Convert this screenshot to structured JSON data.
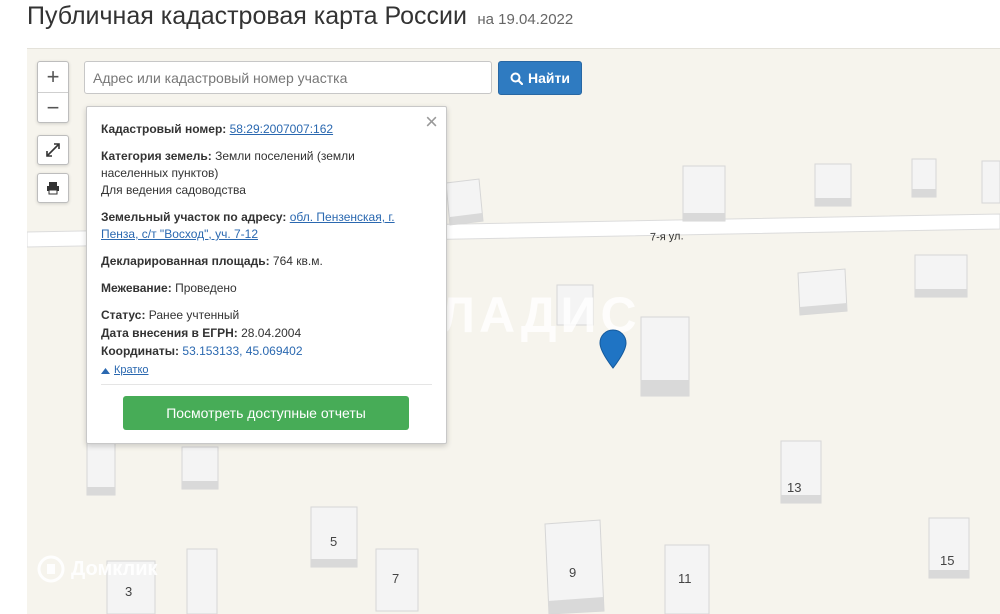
{
  "header": {
    "title": "Публичная кадастровая карта России",
    "date": "на 19.04.2022"
  },
  "search": {
    "placeholder": "Адрес или кадастровый номер участка",
    "value": "",
    "button_label": "Найти"
  },
  "map_controls": {
    "zoom_in": "+",
    "zoom_out": "−"
  },
  "popup": {
    "cadastral_label": "Кадастровый номер:",
    "cadastral_value": "58:29:2007007:162",
    "category_label": "Категория земель:",
    "category_value": "Земли поселений (земли населенных пунктов)",
    "usage_value": "Для ведения садоводства",
    "address_label": "Земельный участок по адресу:",
    "address_value": "обл. Пензенская, г. Пенза, с/т \"Восход\", уч. 7-12",
    "area_label": "Декларированная площадь:",
    "area_value": "764 кв.м.",
    "survey_label": "Межевание:",
    "survey_value": "Проведено",
    "status_label": "Статус:",
    "status_value": "Ранее учтенный",
    "egrn_label": "Дата внесения в ЕГРН:",
    "egrn_value": "28.04.2004",
    "coords_label": "Координаты:",
    "coords_value": "53.153133, 45.069402",
    "collapse_label": "Кратко",
    "reports_button": "Посмотреть доступные отчеты",
    "close_symbol": "×"
  },
  "map": {
    "street_label": "7-я ул.",
    "house_numbers": [
      "3",
      "5",
      "7",
      "9",
      "11",
      "13",
      "15"
    ]
  },
  "watermarks": {
    "vladis": "ВЛАДИС",
    "domclick": "Домклик"
  },
  "colors": {
    "search_button": "#2f7bc1",
    "reports_button": "#47ac57",
    "link": "#2a68b0",
    "pin": "#1f74c4"
  }
}
